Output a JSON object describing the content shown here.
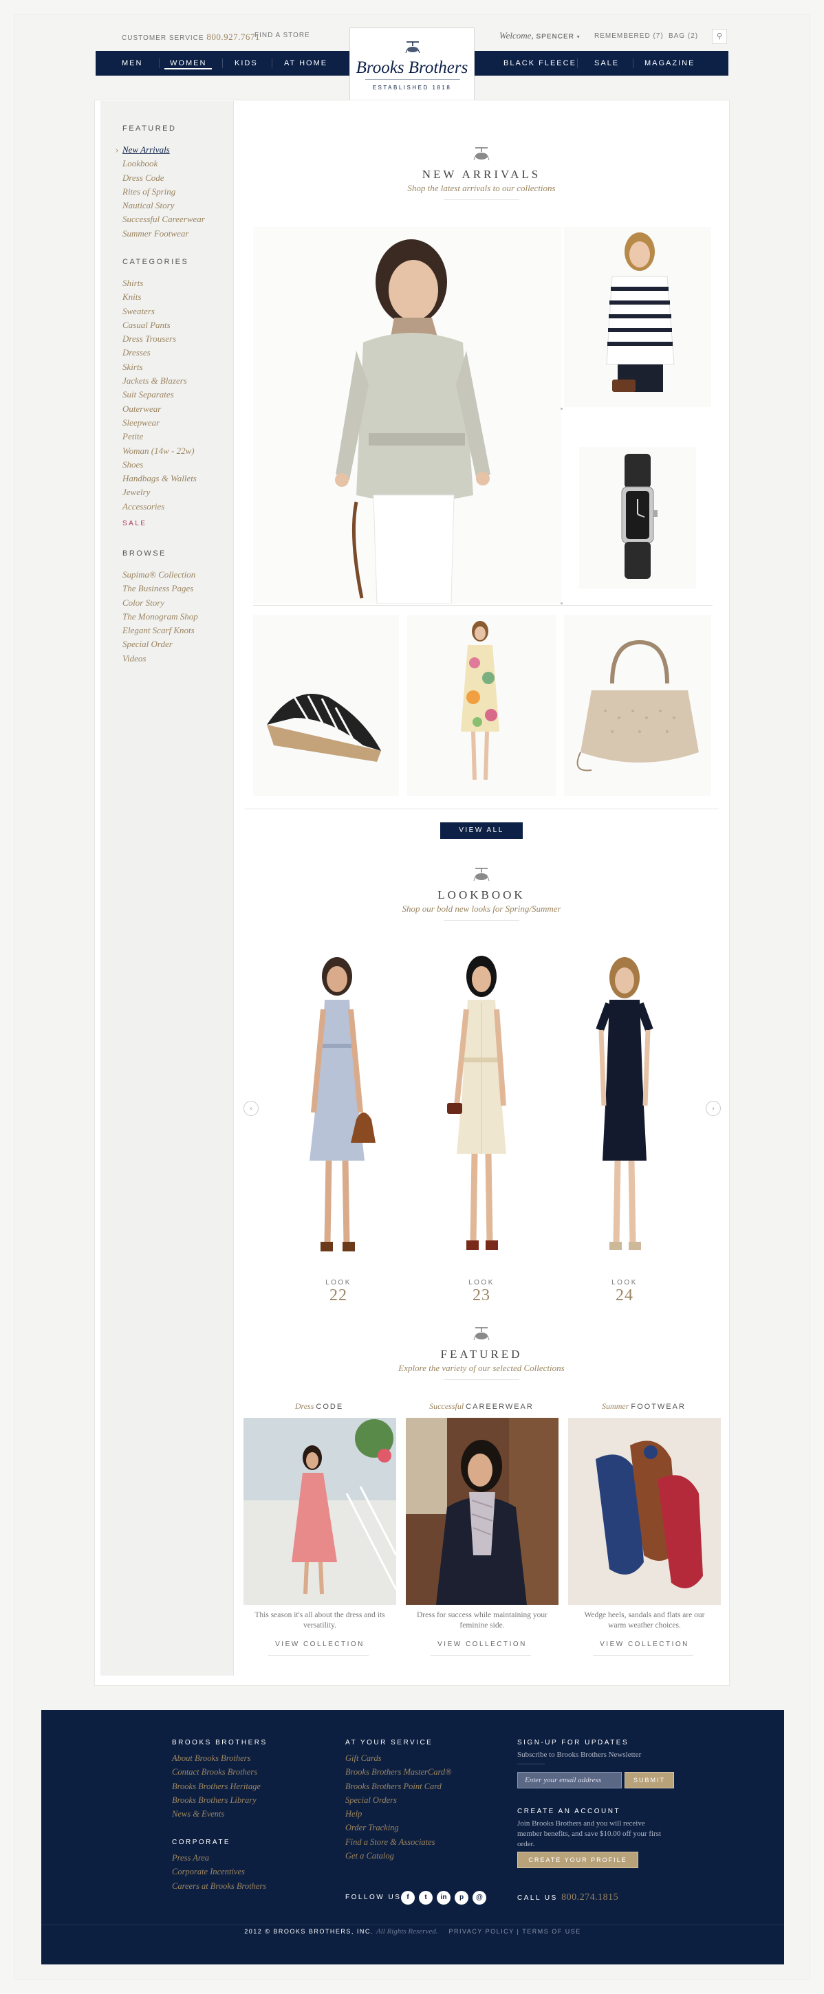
{
  "header": {
    "customer_service": "CUSTOMER SERVICE",
    "phone": "800.927.7671",
    "find_store": "FIND A STORE",
    "welcome": "Welcome,",
    "user": "SPENCER",
    "remembered": "REMEMBERED (7)",
    "bag": "BAG (2)",
    "search_icon": "search-icon"
  },
  "nav": {
    "items": [
      "MEN",
      "WOMEN",
      "KIDS",
      "AT HOME",
      "BLACK FLEECE",
      "SALE",
      "MAGAZINE"
    ],
    "active": "WOMEN"
  },
  "logo": {
    "name": "Brooks Brothers",
    "established": "ESTABLISHED 1818"
  },
  "sidebar": {
    "featured_title": "FEATURED",
    "featured": [
      "New Arrivals",
      "Lookbook",
      "Dress Code",
      "Rites of Spring",
      "Nautical Story",
      "Successful Careerwear",
      "Summer Footwear"
    ],
    "categories_title": "CATEGORIES",
    "categories": [
      "Shirts",
      "Knits",
      "Sweaters",
      "Casual Pants",
      "Dress Trousers",
      "Dresses",
      "Skirts",
      "Jackets & Blazers",
      "Suit Separates",
      "Outerwear",
      "Sleepwear",
      "Petite",
      "Woman (14w - 22w)",
      "Shoes",
      "Handbags & Wallets",
      "Jewelry",
      "Accessories"
    ],
    "sale": "SALE",
    "browse_title": "BROWSE",
    "browse": [
      "Supima® Collection",
      "The Business Pages",
      "Color Story",
      "The Monogram Shop",
      "Elegant Scarf Knots",
      "Special Order",
      "Videos"
    ]
  },
  "new_arrivals": {
    "title": "NEW ARRIVALS",
    "subtitle": "Shop the latest arrivals to our collections",
    "view_all": "VIEW ALL"
  },
  "lookbook": {
    "title": "LOOKBOOK",
    "subtitle": "Shop our bold new looks for Spring/Summer",
    "look_label": "LOOK",
    "looks": [
      "22",
      "23",
      "24"
    ]
  },
  "featured": {
    "title": "FEATURED",
    "subtitle": "Explore the variety of our selected Collections",
    "collections": [
      {
        "italic": "Dress",
        "caps": "CODE",
        "desc": "This season it's all about the dress and its versatility.",
        "link": "VIEW COLLECTION"
      },
      {
        "italic": "Successful",
        "caps": "CAREERWEAR",
        "desc": "Dress for success while maintaining your feminine side.",
        "link": "VIEW COLLECTION"
      },
      {
        "italic": "Summer",
        "caps": "FOOTWEAR",
        "desc": "Wedge heels, sandals and flats are our warm weather choices.",
        "link": "VIEW COLLECTION"
      }
    ]
  },
  "footer": {
    "col1_title": "BROOKS BROTHERS",
    "col1": [
      "About Brooks Brothers",
      "Contact Brooks Brothers",
      "Brooks Brothers Heritage",
      "Brooks Brothers Library",
      "News & Events"
    ],
    "corporate_title": "CORPORATE",
    "corporate": [
      "Press Area",
      "Corporate Incentives",
      "Careers at Brooks Brothers"
    ],
    "col2_title": "AT YOUR SERVICE",
    "col2": [
      "Gift Cards",
      "Brooks Brothers MasterCard®",
      "Brooks Brothers Point Card",
      "Special Orders",
      "Help",
      "Order Tracking",
      "Find a Store & Associates",
      "Get a Catalog"
    ],
    "signup_title": "SIGN-UP for UPDATES",
    "signup_text": "Subscribe to Brooks Brothers Newsletter",
    "email_placeholder": "Enter your email address",
    "submit": "SUBMIT",
    "account_title": "CREATE AN ACCOUNT",
    "account_text": "Join Brooks Brothers and you will receive member benefits, and save $10.00 off your first order.",
    "profile_button": "CREATE YOUR PROFILE",
    "follow": "FOLLOW US",
    "social": [
      "f",
      "t",
      "in",
      "p",
      "@"
    ],
    "call": "CALL US",
    "call_number": "800.274.1815",
    "copyright": "2012 © BROOKS BROTHERS, INC.",
    "rights": "All Rights Reserved.",
    "privacy": "PRIVACY POLICY",
    "terms": "TERMS OF USE"
  },
  "colors": {
    "navy": "#0d2147",
    "gold": "#9b8560",
    "sale": "#b1364f"
  }
}
